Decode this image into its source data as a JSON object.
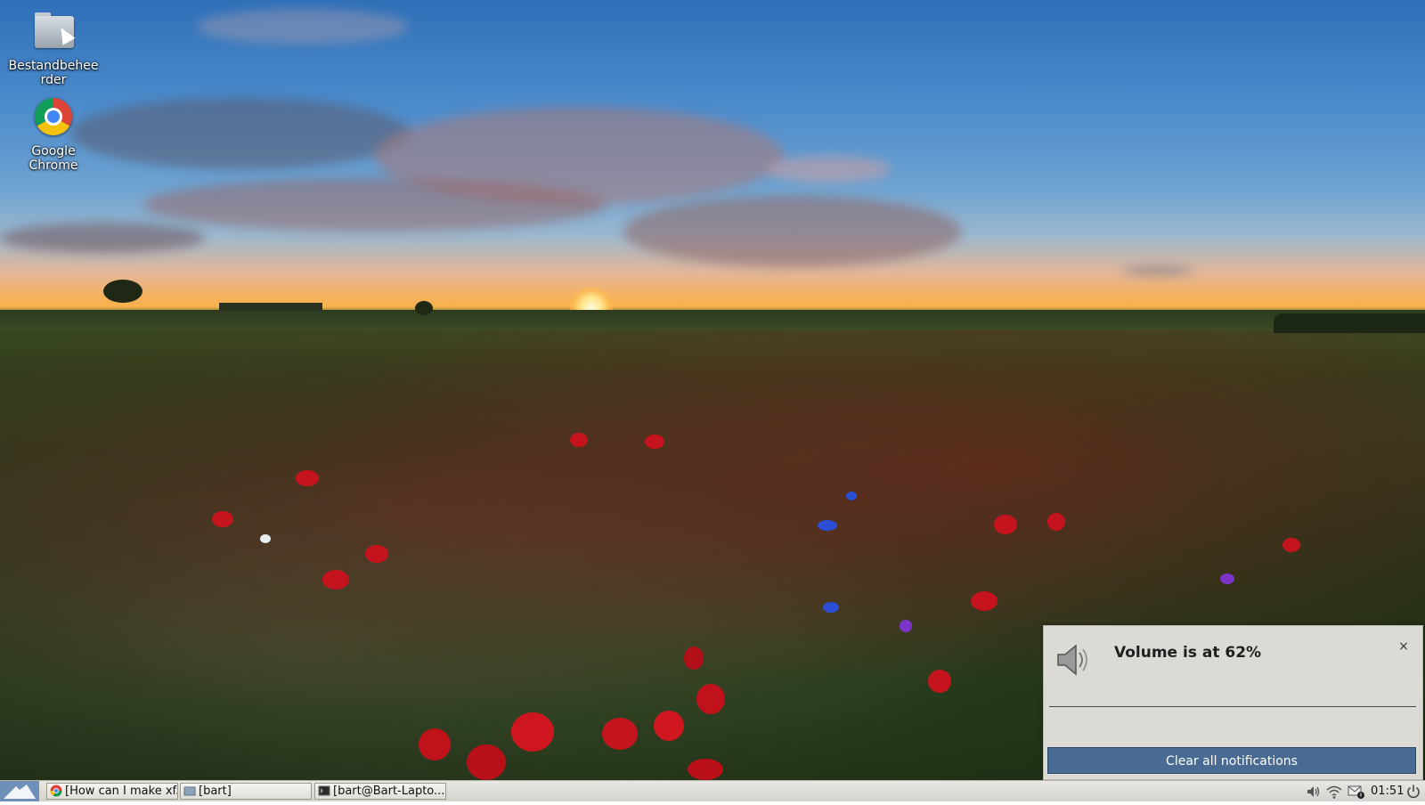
{
  "desktop": {
    "icons": [
      {
        "label": "Bestandbeheerder",
        "icon": "folder-icon"
      },
      {
        "label": "Google Chrome",
        "icon": "chrome-icon"
      }
    ]
  },
  "notification": {
    "title": "Volume is at 62%",
    "icon": "speaker-icon",
    "close_symbol": "×",
    "clear_label": "Clear all notifications"
  },
  "taskbar": {
    "tasks": [
      {
        "label": "[How can I make xf...",
        "icon": "chrome-icon"
      },
      {
        "label": "[bart]",
        "icon": "folder-icon"
      },
      {
        "label": "[bart@Bart-Lapto...",
        "icon": "terminal-icon"
      }
    ],
    "tray": {
      "volume_icon": "speaker-icon",
      "wifi_icon": "wifi-icon",
      "notification_icon": "notification-icon",
      "clock": "01:51",
      "power_icon": "power-icon"
    }
  },
  "colors": {
    "clear_button": "#496a92",
    "panel": "#dcdad5"
  }
}
